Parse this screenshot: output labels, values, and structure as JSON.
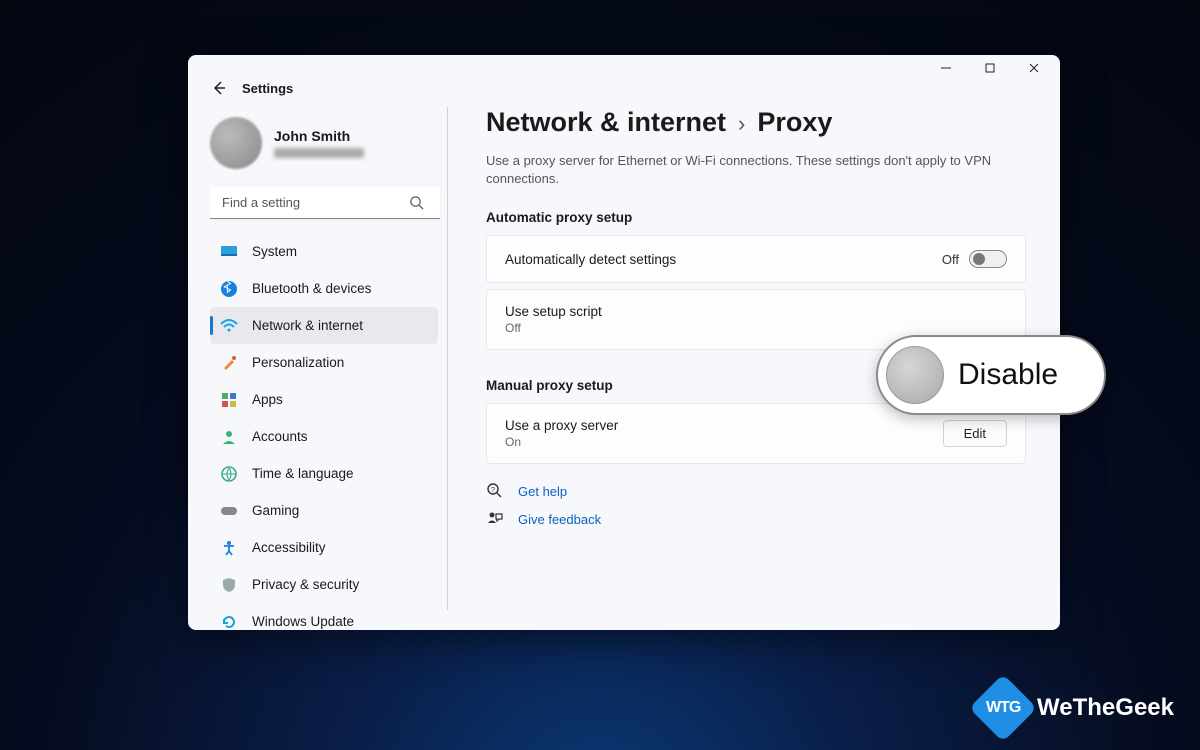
{
  "app_title": "Settings",
  "user": {
    "name": "John Smith"
  },
  "search": {
    "placeholder": "Find a setting"
  },
  "sidebar": {
    "items": [
      {
        "label": "System"
      },
      {
        "label": "Bluetooth & devices"
      },
      {
        "label": "Network & internet"
      },
      {
        "label": "Personalization"
      },
      {
        "label": "Apps"
      },
      {
        "label": "Accounts"
      },
      {
        "label": "Time & language"
      },
      {
        "label": "Gaming"
      },
      {
        "label": "Accessibility"
      },
      {
        "label": "Privacy & security"
      },
      {
        "label": "Windows Update"
      }
    ],
    "selected_index": 2
  },
  "breadcrumb": {
    "parent": "Network & internet",
    "current": "Proxy"
  },
  "description": "Use a proxy server for Ethernet or Wi-Fi connections. These settings don't apply to VPN connections.",
  "sections": {
    "auto": {
      "title": "Automatic proxy setup",
      "detect": {
        "label": "Automatically detect settings",
        "state_label": "Off",
        "on": false
      },
      "script": {
        "label": "Use setup script",
        "state_label": "Off"
      }
    },
    "manual": {
      "title": "Manual proxy setup",
      "proxy": {
        "label": "Use a proxy server",
        "state_label": "On",
        "button": "Edit"
      }
    }
  },
  "links": {
    "help": "Get help",
    "feedback": "Give feedback"
  },
  "callout": {
    "label": "Disable"
  },
  "watermark": {
    "badge": "WTG",
    "text": "WeTheGeek"
  }
}
